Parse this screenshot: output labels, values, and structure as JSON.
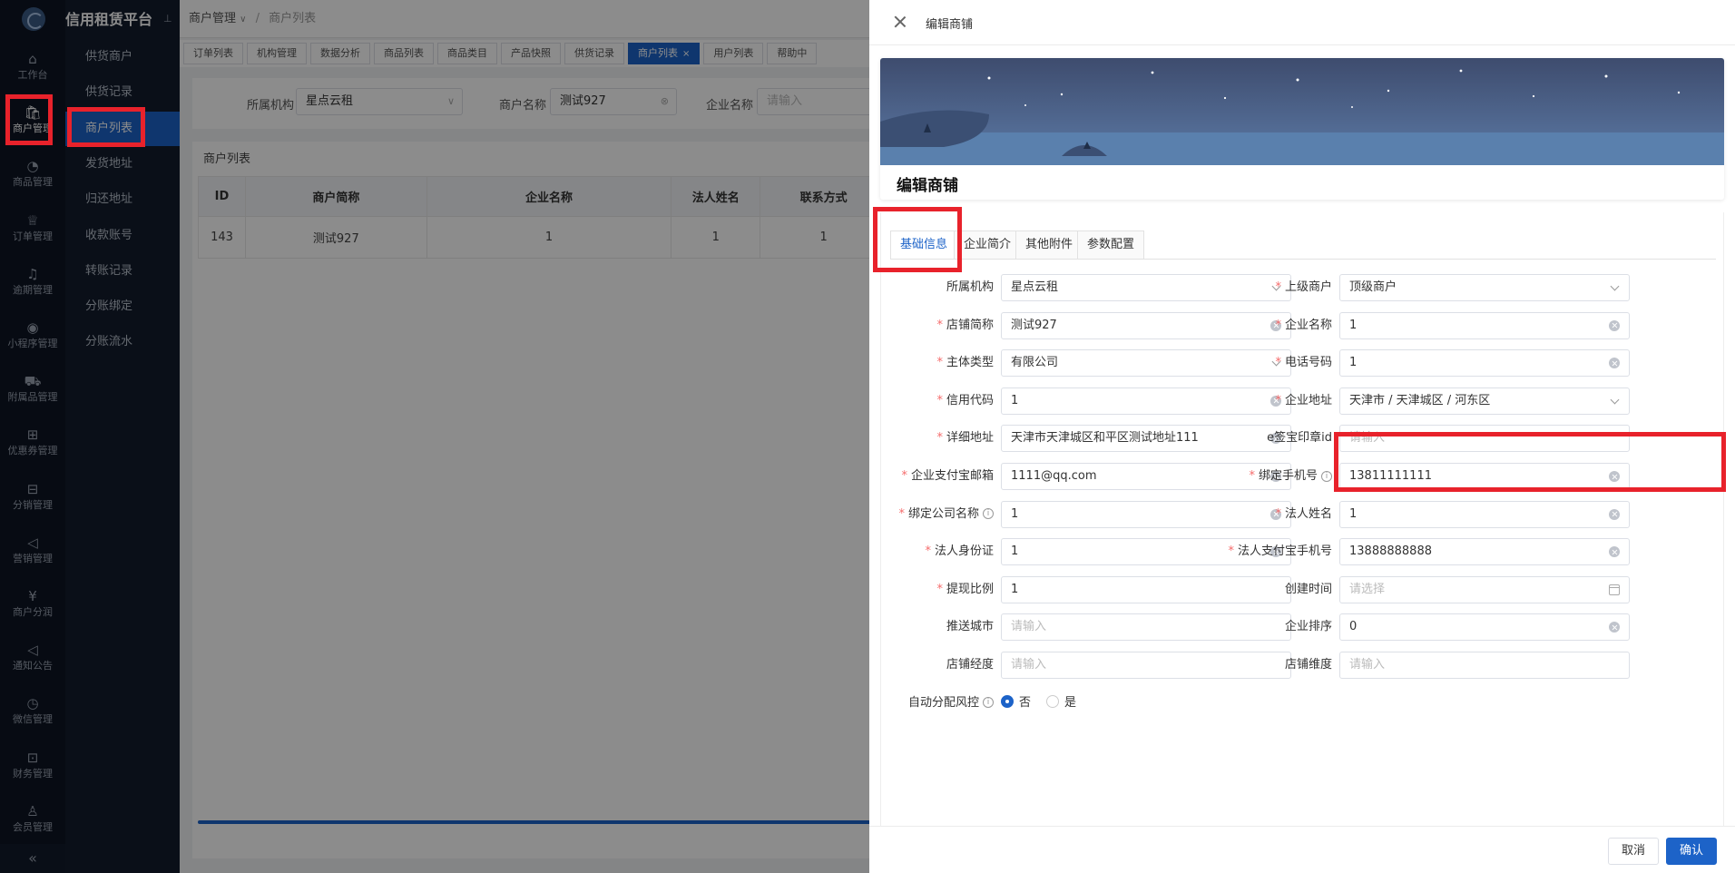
{
  "app": {
    "title": "信用租赁平台"
  },
  "rail": {
    "items": [
      {
        "icon": "home-icon",
        "glyph": "⌂",
        "label": "工作台"
      },
      {
        "icon": "bag-icon",
        "glyph": "🛍",
        "label": "商户管理"
      },
      {
        "icon": "apple-icon",
        "glyph": "◔",
        "label": "商品管理"
      },
      {
        "icon": "trophy-icon",
        "glyph": "♕",
        "label": "订单管理"
      },
      {
        "icon": "bell-icon",
        "glyph": "♫",
        "label": "逾期管理"
      },
      {
        "icon": "watch-icon",
        "glyph": "◉",
        "label": "小程序管理"
      },
      {
        "icon": "cart-icon",
        "glyph": "⛟",
        "label": "附属品管理"
      },
      {
        "icon": "gift-icon",
        "glyph": "⊞",
        "label": "优惠券管理"
      },
      {
        "icon": "sliders-icon",
        "glyph": "⊟",
        "label": "分销管理"
      },
      {
        "icon": "megaphone-icon",
        "glyph": "◁",
        "label": "营销管理"
      },
      {
        "icon": "yen-icon",
        "glyph": "¥",
        "label": "商户分润"
      },
      {
        "icon": "notice-icon",
        "glyph": "◁",
        "label": "通知公告"
      },
      {
        "icon": "wechat-icon",
        "glyph": "◷",
        "label": "微信管理"
      },
      {
        "icon": "finance-icon",
        "glyph": "⊡",
        "label": "财务管理"
      },
      {
        "icon": "user-icon",
        "glyph": "♙",
        "label": "会员管理"
      }
    ],
    "collapse_glyph": "«"
  },
  "submenu": {
    "items": [
      "供货商户",
      "供货记录",
      "商户列表",
      "发货地址",
      "归还地址",
      "收款账号",
      "转账记录",
      "分账绑定",
      "分账流水"
    ]
  },
  "breadcrumb": {
    "parent": "商户管理",
    "current": "商户列表"
  },
  "tabs": [
    "订单列表",
    "机构管理",
    "数据分析",
    "商品列表",
    "商品类目",
    "产品快照",
    "供货记录",
    "商户列表",
    "用户列表",
    "帮助中"
  ],
  "filter": {
    "org_label": "所属机构",
    "org_value": "星点云租",
    "name_label": "商户名称",
    "name_value": "测试927",
    "company_label": "企业名称",
    "company_placeholder": "请输入"
  },
  "list": {
    "title": "商户列表",
    "columns": [
      "ID",
      "商户简称",
      "企业名称",
      "法人姓名",
      "联系方式"
    ],
    "rows": [
      [
        "143",
        "测试927",
        "1",
        "1",
        "1"
      ]
    ]
  },
  "drawer": {
    "header_title": "编辑商铺",
    "banner_title": "编辑商铺",
    "tabs": [
      "基础信息",
      "企业简介",
      "其他附件",
      "参数配置"
    ],
    "fields": {
      "org": {
        "label": "所属机构",
        "value": "星点云租"
      },
      "parent": {
        "label": "上级商户",
        "value": "顶级商户"
      },
      "shop_short": {
        "label": "店铺简称",
        "value": "测试927"
      },
      "company": {
        "label": "企业名称",
        "value": "1"
      },
      "entity_type": {
        "label": "主体类型",
        "value": "有限公司"
      },
      "phone": {
        "label": "电话号码",
        "value": "1"
      },
      "credit_code": {
        "label": "信用代码",
        "value": "1"
      },
      "company_addr": {
        "label": "企业地址",
        "value": "天津市 / 天津城区 / 河东区"
      },
      "detail_addr": {
        "label": "详细地址",
        "value": "天津市天津城区和平区测试地址111"
      },
      "esign_id": {
        "label": "e签宝印章id",
        "placeholder": "请输入"
      },
      "alipay_email": {
        "label": "企业支付宝邮箱",
        "value": "1111@qq.com"
      },
      "bind_phone": {
        "label": "绑定手机号",
        "value": "13811111111"
      },
      "bind_company": {
        "label": "绑定公司名称",
        "value": "1"
      },
      "legal_name": {
        "label": "法人姓名",
        "value": "1"
      },
      "legal_id": {
        "label": "法人身份证",
        "value": "1"
      },
      "legal_alipay_phone": {
        "label": "法人支付宝手机号",
        "value": "13888888888"
      },
      "withdraw_ratio": {
        "label": "提现比例",
        "value": "1"
      },
      "created_at": {
        "label": "创建时间",
        "placeholder": "请选择"
      },
      "push_city": {
        "label": "推送城市",
        "placeholder": "请输入"
      },
      "sort": {
        "label": "企业排序",
        "value": "0"
      },
      "longitude": {
        "label": "店铺经度",
        "placeholder": "请输入"
      },
      "latitude": {
        "label": "店铺维度",
        "placeholder": "请输入"
      },
      "auto_risk": {
        "label": "自动分配风控",
        "option_no": "否",
        "option_yes": "是",
        "selected": "否"
      }
    },
    "cancel_label": "取消",
    "confirm_label": "确认"
  },
  "colors": {
    "primary": "#1d63c8",
    "highlight": "#e8222b",
    "rail_bg": "#0d1524",
    "required": "#f56c6c"
  }
}
